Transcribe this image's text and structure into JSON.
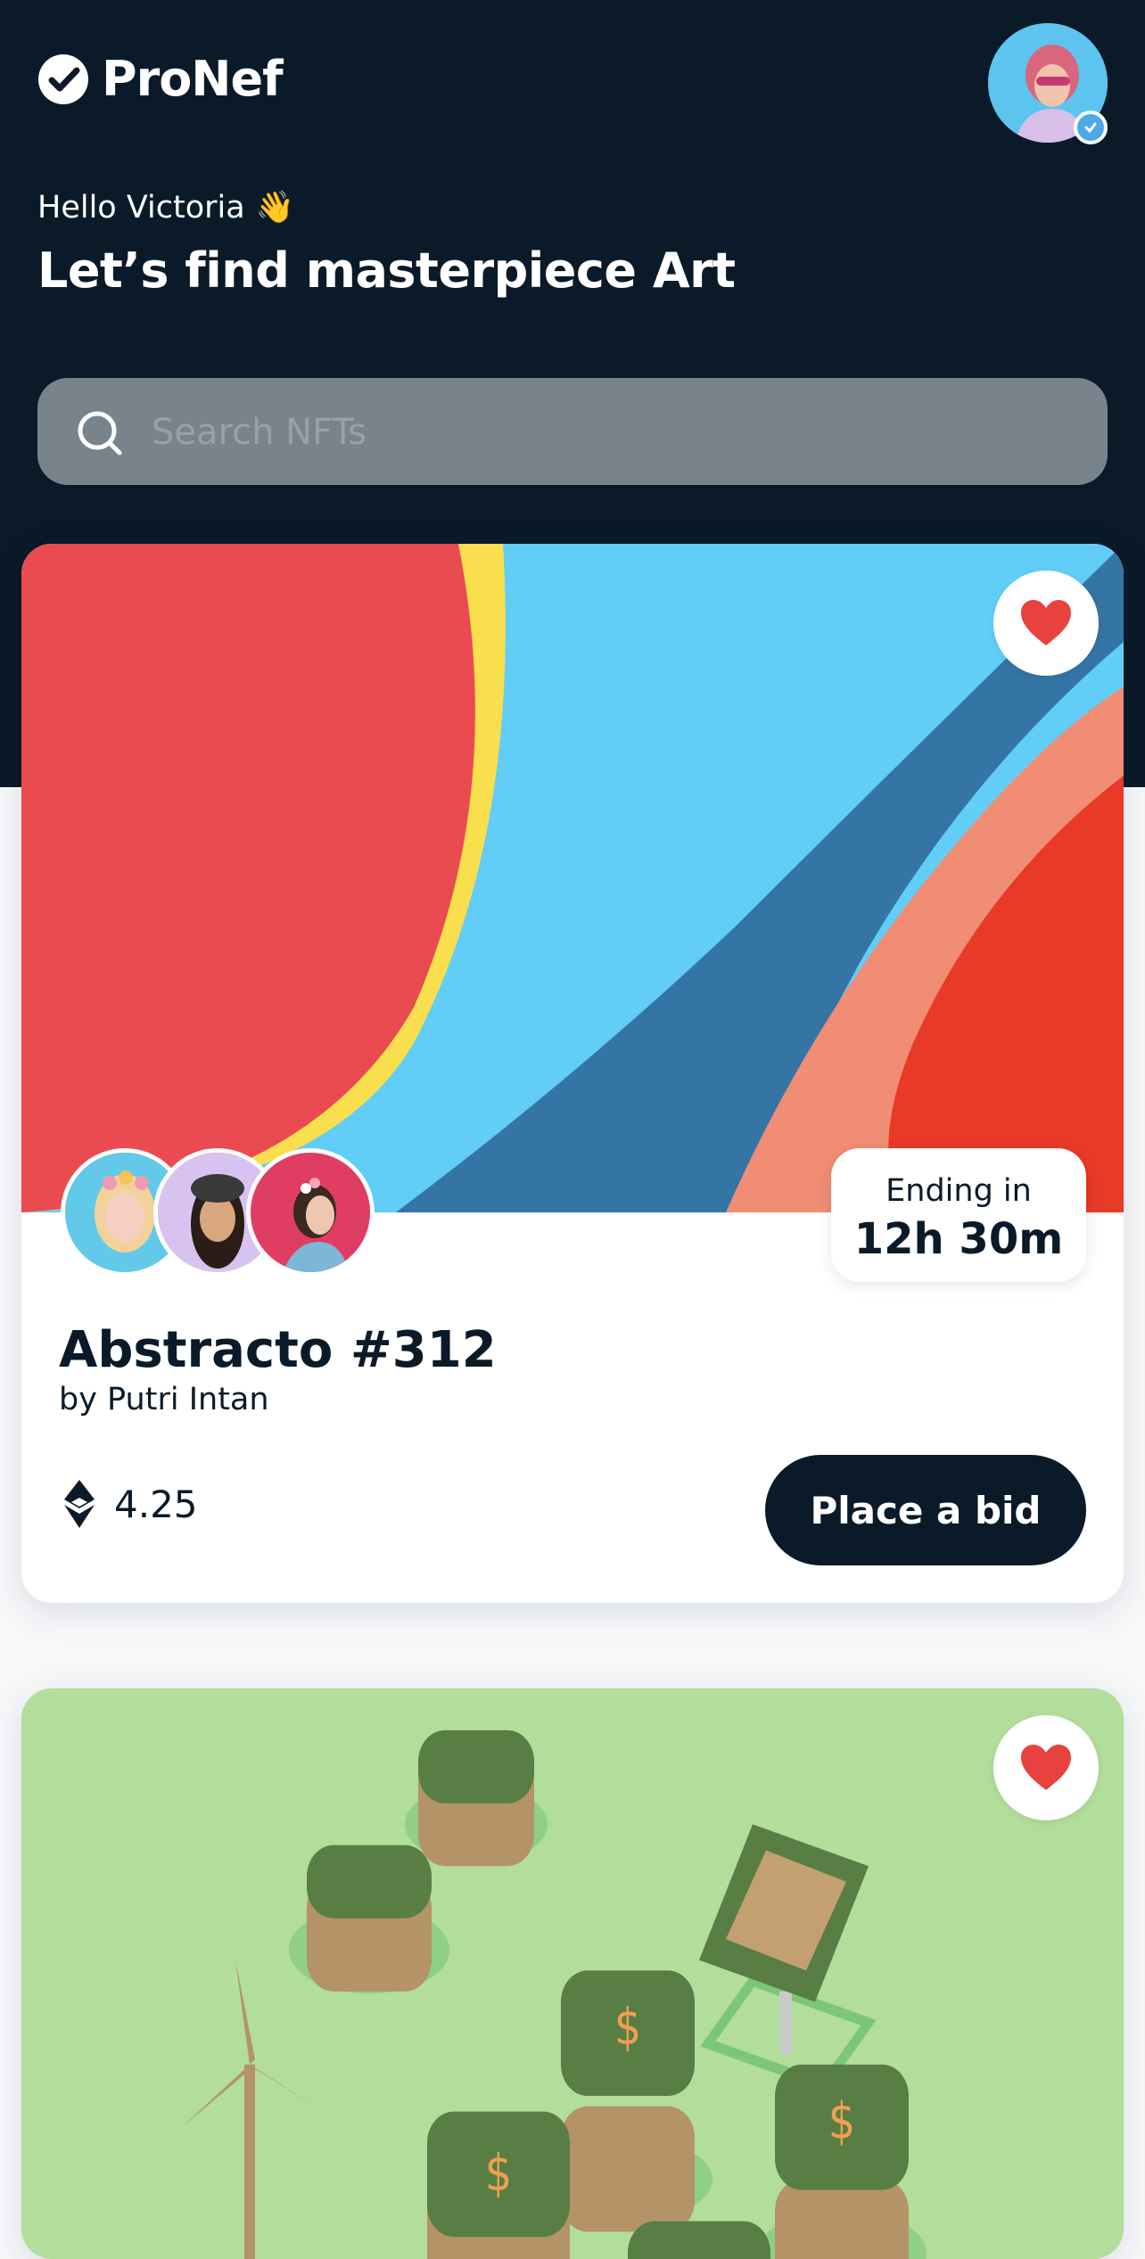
{
  "brand": {
    "name": "ProNef"
  },
  "user": {
    "greeting": "Hello Victoria",
    "greeting_emoji": "👋"
  },
  "headline": "Let’s find masterpiece Art",
  "search": {
    "placeholder": "Search NFTs",
    "value": ""
  },
  "cards": [
    {
      "title": "Abstracto #312",
      "author": "by Putri Intan",
      "ending_label": "Ending in",
      "ending_time": "12h 30m",
      "price": "4.25",
      "currency_icon": "ethereum-icon",
      "bid_label": "Place a bid",
      "liked": true
    },
    {
      "liked": true
    }
  ],
  "colors": {
    "navy": "#0b1a29",
    "heart": "#e8423f",
    "art_red": "#e94b50",
    "art_yellow": "#f9df4d",
    "art_sky": "#62cdf6",
    "art_blue": "#3475a6",
    "art_peach": "#f08d74",
    "art_orange": "#e83a26",
    "green_bg": "#b2dd9a"
  }
}
